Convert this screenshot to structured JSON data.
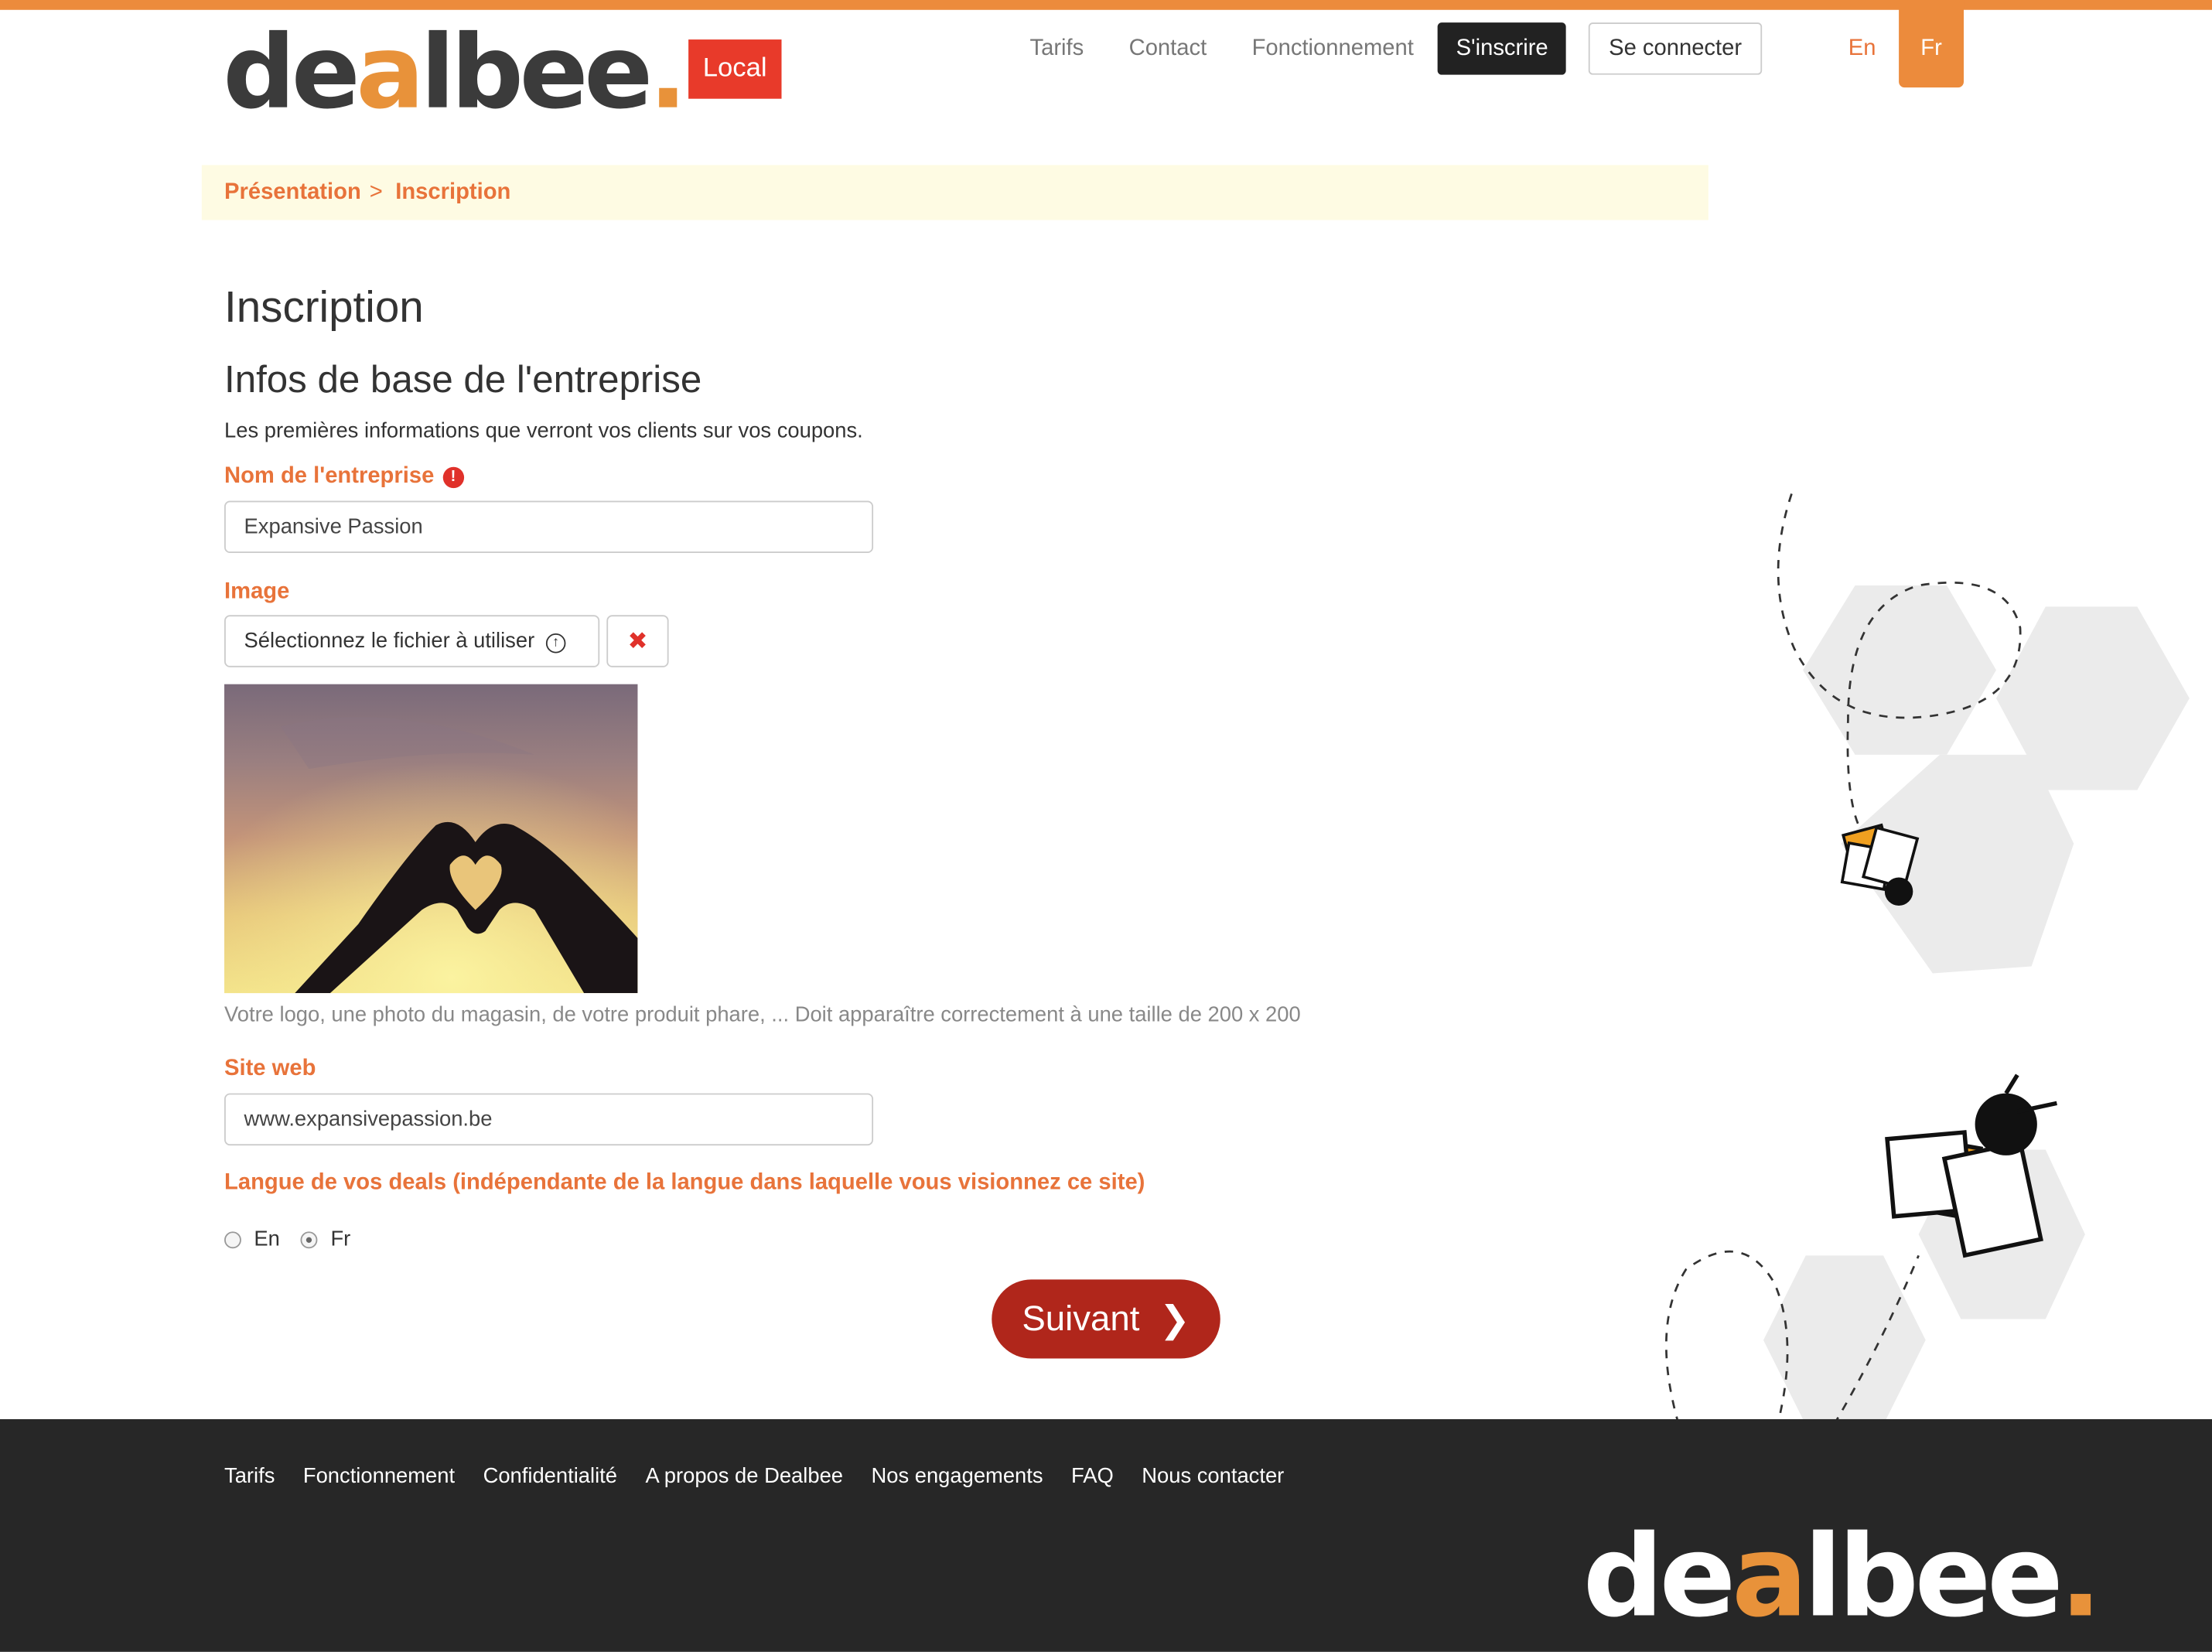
{
  "header": {
    "logo_text_before": "de",
    "logo_text_a": "a",
    "logo_text_after": "lbee",
    "logo_dot": ".",
    "badge": "Local",
    "nav": {
      "tarifs": "Tarifs",
      "contact": "Contact",
      "fonctionnement": "Fonctionnement",
      "signup": "S'inscrire",
      "login": "Se connecter"
    },
    "lang_en": "En",
    "lang_fr": "Fr"
  },
  "breadcrumb": {
    "home": "Présentation",
    "separator": ">",
    "current": "Inscription"
  },
  "page": {
    "title": "Inscription",
    "subtitle": "Infos de base de l'entreprise",
    "intro": "Les premières informations que verront vos clients sur vos coupons."
  },
  "form": {
    "company_label": "Nom de l'entreprise",
    "company_value": "Expansive Passion",
    "image_label": "Image",
    "file_button": "Sélectionnez le fichier à utiliser",
    "image_help": "Votre logo, une photo du magasin, de votre produit phare, ... Doit apparaître correctement à une taille de 200 x 200",
    "website_label": "Site web",
    "website_value": "www.expansivepassion.be",
    "language_label": "Langue de vos deals (indépendante de la langue dans laquelle vous visionnez ce site)",
    "language_options": [
      "En",
      "Fr"
    ],
    "language_selected": "Fr",
    "submit": "Suivant"
  },
  "footer": {
    "links": [
      "Tarifs",
      "Fonctionnement",
      "Confidentialité",
      "A propos de Dealbee",
      "Nos engagements",
      "FAQ",
      "Nous contacter"
    ]
  },
  "colors": {
    "brand_orange": "#ec8b3c",
    "label_orange": "#e8733a",
    "submit_red": "#b0261b",
    "footer_bg": "#272727"
  }
}
